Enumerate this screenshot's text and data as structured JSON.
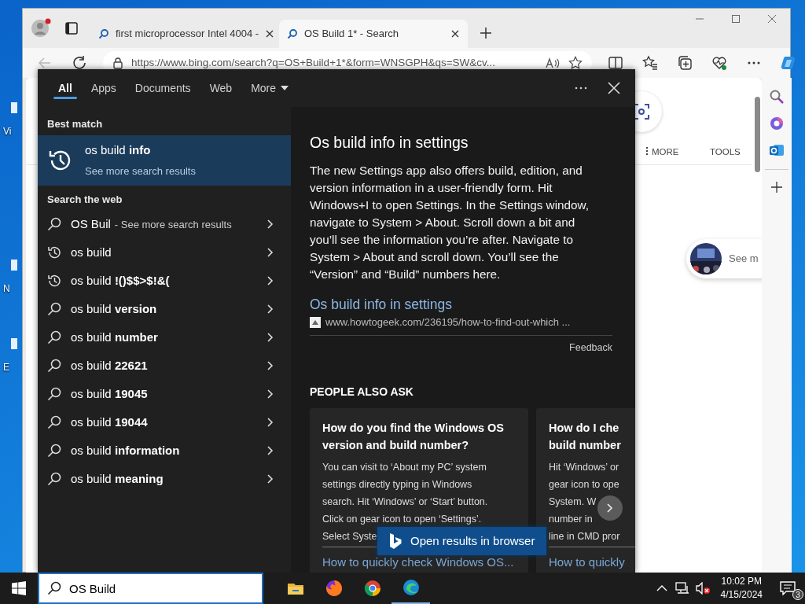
{
  "desktop_icons": [
    {
      "label": "Vi"
    },
    {
      "label": "N"
    },
    {
      "label": "E"
    }
  ],
  "browser": {
    "tabs": [
      {
        "title": "first microprocessor Intel 4004 -",
        "selected": false
      },
      {
        "title": "OS Build 1* - Search",
        "selected": true
      }
    ],
    "address": "https://www.bing.com/search?q=OS+Build+1*&form=WNSGPH&qs=SW&cv...",
    "page": {
      "more_button": "MORE",
      "tools_button": "TOOLS",
      "see_more": "See m"
    }
  },
  "search_panel": {
    "tabs": [
      {
        "label": "All",
        "selected": true,
        "dropdown": false
      },
      {
        "label": "Apps",
        "selected": false,
        "dropdown": false
      },
      {
        "label": "Documents",
        "selected": false,
        "dropdown": false
      },
      {
        "label": "Web",
        "selected": false,
        "dropdown": false
      },
      {
        "label": "More",
        "selected": false,
        "dropdown": true
      }
    ],
    "best_match": {
      "heading": "Best match",
      "title": "os build **info**",
      "subtitle": "See more search results",
      "selected": true
    },
    "web": {
      "heading": "Search the web",
      "suggestions": [
        {
          "kind": "search",
          "text": "OS Buil",
          "hint": "- See more search results"
        },
        {
          "kind": "history",
          "text": "os build"
        },
        {
          "kind": "history",
          "text": "os build **!()$$>$!&(**"
        },
        {
          "kind": "search",
          "text": "os build **version**"
        },
        {
          "kind": "search",
          "text": "os build **number**"
        },
        {
          "kind": "search",
          "text": "os build **22621**"
        },
        {
          "kind": "search",
          "text": "os build **19045**"
        },
        {
          "kind": "search",
          "text": "os build **19044**"
        },
        {
          "kind": "search",
          "text": "os build **information**"
        },
        {
          "kind": "search",
          "text": "os build **meaning**"
        }
      ]
    },
    "preview": {
      "title": "Os build info in settings",
      "body_lines": [
        "The new Settings app also offers build, edition, and",
        "version information in a user-friendly form. Hit",
        "Windows+I to open Settings. In the Settings window,",
        "navigate to System > About. Scroll down a bit and",
        "you’ll see the information you’re after. Navigate to",
        "System > About and scroll down. You’ll see the",
        "“Version” and “Build” numbers here."
      ],
      "link": "Os build info in settings",
      "url": "www.howtogeek.com/236195/how-to-find-out-which ...",
      "feedback": "Feedback"
    },
    "people_also_ask": {
      "heading": "PEOPLE ALSO ASK",
      "cards": [
        {
          "question_lines": [
            "How do you find the Windows OS",
            "version and build number?"
          ],
          "answer_lines": [
            "You can visit to ‘About my PC’ system",
            "settings directly typing in Windows",
            "search. Hit ‘Windows’ or ‘Start’ button.",
            "Click on gear icon to open ‘Settings’.",
            "Select Syste"
          ],
          "link": "How to quickly check Windows OS..."
        },
        {
          "question_lines": [
            "How do I che",
            "build number"
          ],
          "answer_lines": [
            "Hit ‘Windows’ or",
            "gear icon to ope",
            "System. W",
            "number in",
            "line in CMD pror"
          ],
          "link": "How to quickly"
        }
      ]
    },
    "open_in_browser": "Open results in browser"
  },
  "taskbar": {
    "search_value": "OS Build",
    "apps": [
      {
        "kind": "folder",
        "active": false
      },
      {
        "kind": "firefox",
        "active": false
      },
      {
        "kind": "chrome",
        "active": false
      },
      {
        "kind": "edge",
        "active": true
      }
    ],
    "time": "10:02 PM",
    "date": "4/15/2024",
    "notifications": "3"
  }
}
